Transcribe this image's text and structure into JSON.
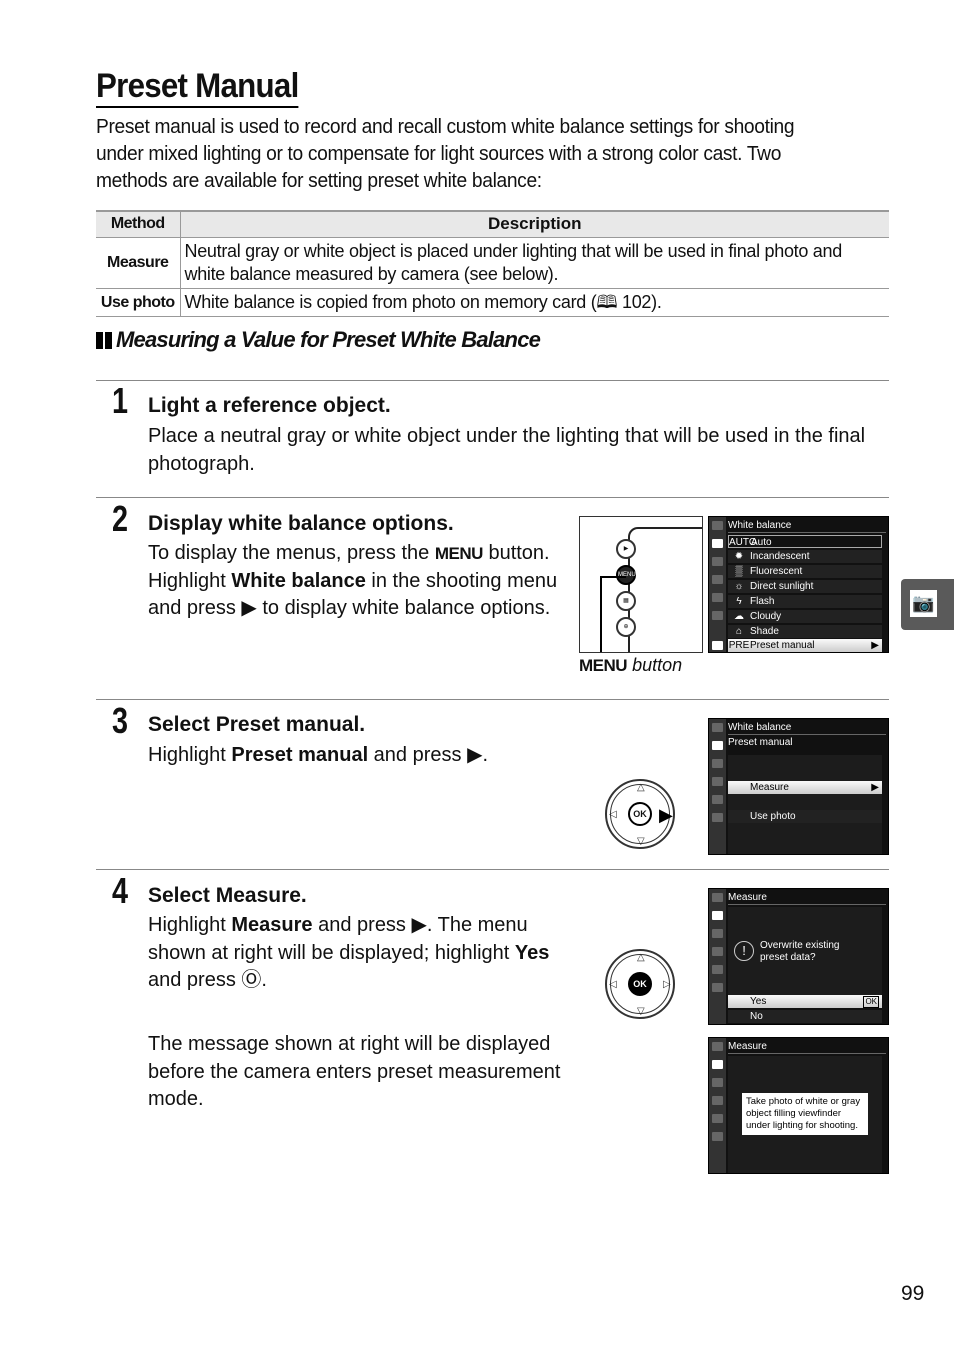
{
  "title": "Preset Manual",
  "intro": [
    "Preset manual is used to record and recall custom white balance settings for shooting",
    "under mixed lighting or to compensate for light sources with a strong color cast.  Two",
    "methods are available for setting preset white balance:"
  ],
  "table": {
    "headers": [
      "Method",
      "Description"
    ],
    "rows": [
      {
        "method": "Measure",
        "description": "Neutral gray or white object is placed under lighting that will be used in final photo and white balance measured by camera (see below)."
      },
      {
        "method": "Use photo",
        "description": "White balance is copied from photo on memory card (🕮 102)."
      }
    ]
  },
  "subheading": "Measuring a Value for Preset White Balance",
  "steps": [
    {
      "number": "1",
      "title": "Light a reference object.",
      "body": "Place a neutral gray or white object under the lighting that will be used in the final photograph."
    },
    {
      "number": "2",
      "title": "Display white balance options.",
      "body_parts": {
        "a": "To display the menus, press the ",
        "menu": "MENU",
        "b": " button. Highlight ",
        "bold": "White balance",
        "c": " in the shooting menu and press ▶ to display white balance options."
      }
    },
    {
      "number": "3",
      "title_a": "Select ",
      "title_b": "Preset manual.",
      "body_a": "Highlight ",
      "body_bold": "Preset manual",
      "body_b": " and press ▶."
    },
    {
      "number": "4",
      "title_a": "Select ",
      "title_b": "Measure.",
      "body_a": "Highlight ",
      "body_bold": "Measure",
      "body_b": " and press ▶.  The menu shown at right will be displayed; highlight ",
      "body_bold2": "Yes",
      "body_c": " and press Ⓞ.",
      "body2": "The message shown at right will be displayed before the camera enters preset measurement mode."
    }
  ],
  "camera_caption": {
    "menu": "MENU",
    "rest": " button"
  },
  "lcd1": {
    "header": "White balance",
    "items": [
      {
        "icon": "AUTO",
        "label": "Auto"
      },
      {
        "icon": "✹",
        "label": "Incandescent"
      },
      {
        "icon": "▒",
        "label": "Fluorescent"
      },
      {
        "icon": "☼",
        "label": "Direct sunlight"
      },
      {
        "icon": "ϟ",
        "label": "Flash"
      },
      {
        "icon": "☁",
        "label": "Cloudy"
      },
      {
        "icon": "⌂",
        "label": "Shade"
      },
      {
        "icon": "PRE",
        "label": "Preset manual"
      }
    ],
    "help": "?"
  },
  "lcd2": {
    "header": "White balance",
    "subheader": "Preset manual",
    "items": [
      "Measure",
      "Use photo"
    ]
  },
  "lcd3": {
    "header": "Measure",
    "message": "Overwrite existing preset data?",
    "items": [
      "Yes",
      "No"
    ],
    "ok": "OK"
  },
  "lcd4": {
    "header": "Measure",
    "message": "Take photo of white or gray object filling viewfinder under lighting for shooting."
  },
  "dpad_ok": "OK",
  "page_number": "99"
}
